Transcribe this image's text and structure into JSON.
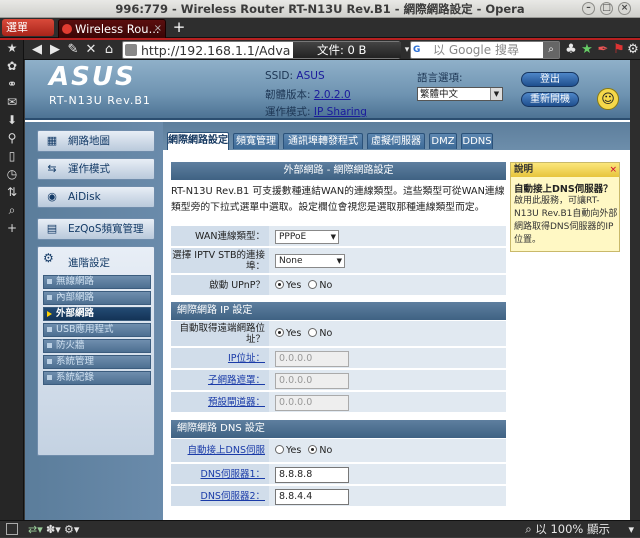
{
  "window": {
    "title": "996:779 - Wireless Router RT-N13U Rev.B1 - 網際網路設定 - Opera"
  },
  "browser": {
    "menu_label": "選單",
    "tab_title": "Wireless Rou...",
    "tab_close": "×",
    "new_tab": "+",
    "url": "http://192.168.1.1/Advance",
    "file_size": "文件:  0 B",
    "search_placeholder": "以 Google 搜尋",
    "zoom": "以 100% 顯示"
  },
  "header": {
    "logo": "ASUS",
    "model": "RT-N13U Rev.B1",
    "ssid_label": "SSID:",
    "ssid_value": "ASUS",
    "firmware_label": "韌體版本:",
    "firmware_value": "2.0.2.0",
    "mode_label": "運作模式:",
    "mode_value": "IP Sharing",
    "lang_label": "語言選項:",
    "lang_value": "繁體中文",
    "logout": "登出",
    "reboot": "重新開機"
  },
  "leftnav": {
    "items": [
      {
        "label": "網路地圖"
      },
      {
        "label": "運作模式"
      },
      {
        "label": "AiDisk"
      },
      {
        "label": "EzQoS頻寬管理"
      }
    ],
    "advanced_title": "進階設定",
    "sub": [
      "無線網路",
      "內部網路",
      "外部網路",
      "USB應用程式",
      "防火牆",
      "系統管理",
      "系統紀錄"
    ]
  },
  "tabs": [
    "網際網路設定",
    "頻寬管理",
    "通訊埠轉發程式",
    "虛擬伺服器",
    "DMZ",
    "DDNS"
  ],
  "content": {
    "title": "外部網路 - 網際網路設定",
    "desc": "RT-N13U Rev.B1 可支援數種連結WAN的連線類型。這些類型可從WAN連線類型旁的下拉式選單中選取。設定欄位會視您是選取那種連線類型而定。",
    "wan_type_label": "WAN連線類型：",
    "wan_type_value": "PPPoE",
    "iptv_label": "選擇 IPTV STB的連接埠：",
    "iptv_value": "None",
    "upnp_label": "啟動 UPnP？",
    "yes": "Yes",
    "no": "No",
    "ip_section": "網際網路 IP 設定",
    "auto_ip_label": "自動取得遠端網路位址？",
    "ip_label": "IP位址：",
    "mask_label": "子網路遮罩：",
    "gateway_label": "預設閘道器：",
    "ip_placeholder": "0.0.0.0",
    "dns_section": "網際網路 DNS 設定",
    "auto_dns_label": "自動接上DNS伺服器？",
    "dns1_label": "DNS伺服器1：",
    "dns1_value": "8.8.8.8",
    "dns2_label": "DNS伺服器2：",
    "dns2_value": "8.8.4.4"
  },
  "help": {
    "title": "說明",
    "close": "×",
    "question": "自動接上DNS伺服器？",
    "text": "啟用此服務，可讓RT-N13U Rev.B1自動向外部網路取得DNS伺服器的IP位置。"
  }
}
